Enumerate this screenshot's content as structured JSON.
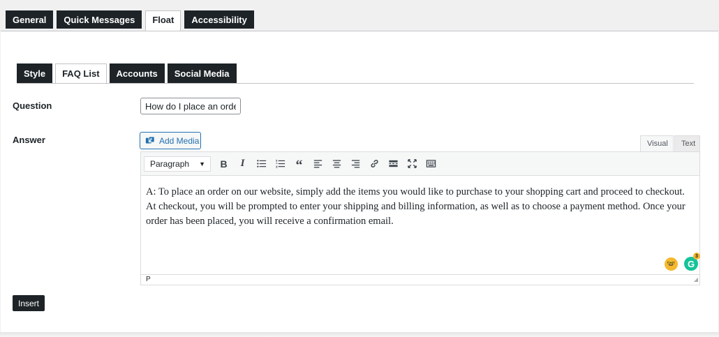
{
  "top_tabs": [
    {
      "label": "General",
      "active": false
    },
    {
      "label": "Quick Messages",
      "active": false
    },
    {
      "label": "Float",
      "active": true
    },
    {
      "label": "Accessibility",
      "active": false
    }
  ],
  "sub_tabs": [
    {
      "label": "Style",
      "active": false
    },
    {
      "label": "FAQ List",
      "active": true
    },
    {
      "label": "Accounts",
      "active": false
    },
    {
      "label": "Social Media",
      "active": false
    }
  ],
  "form": {
    "question_label": "Question",
    "question_value": "How do I place an order?",
    "answer_label": "Answer"
  },
  "editor": {
    "add_media_label": "Add Media",
    "mode_visual": "Visual",
    "mode_text": "Text",
    "format_select": "Paragraph",
    "toolbar_icons": [
      "bold-icon",
      "italic-icon",
      "bullet-list-icon",
      "numbered-list-icon",
      "blockquote-icon",
      "align-left-icon",
      "align-center-icon",
      "align-right-icon",
      "link-icon",
      "read-more-icon",
      "fullscreen-icon",
      "toolbar-toggle-icon"
    ],
    "bold_glyph": "B",
    "italic_glyph": "I",
    "quote_glyph": "“",
    "content": " A: To place an order on our website, simply add the items you would like to purchase to your shopping cart and proceed to checkout. At checkout, you will be prompted to enter your shipping and billing information, as well as to choose a payment method. Once your order has been placed, you will receive a confirmation email.",
    "status_path": "P",
    "grammarly_count": "3"
  },
  "actions": {
    "insert_label": "Insert"
  },
  "colors": {
    "accent": "#2271b1",
    "dark": "#1d2327",
    "grammarly": "#15c39a"
  }
}
